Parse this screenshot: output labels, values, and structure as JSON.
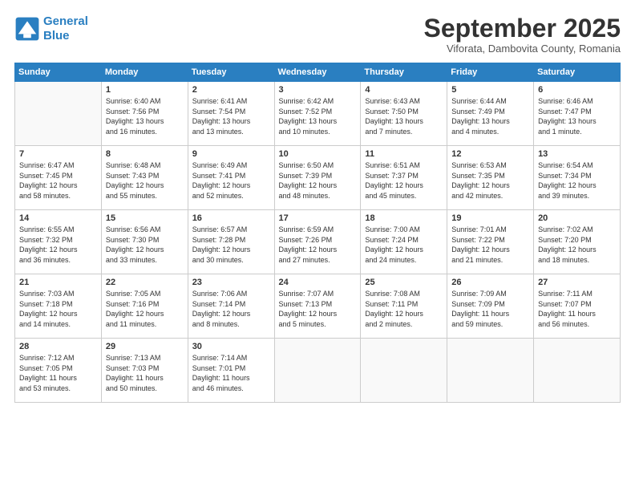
{
  "logo": {
    "line1": "General",
    "line2": "Blue"
  },
  "title": "September 2025",
  "subtitle": "Viforata, Dambovita County, Romania",
  "weekdays": [
    "Sunday",
    "Monday",
    "Tuesday",
    "Wednesday",
    "Thursday",
    "Friday",
    "Saturday"
  ],
  "weeks": [
    [
      {
        "day": "",
        "info": ""
      },
      {
        "day": "1",
        "info": "Sunrise: 6:40 AM\nSunset: 7:56 PM\nDaylight: 13 hours\nand 16 minutes."
      },
      {
        "day": "2",
        "info": "Sunrise: 6:41 AM\nSunset: 7:54 PM\nDaylight: 13 hours\nand 13 minutes."
      },
      {
        "day": "3",
        "info": "Sunrise: 6:42 AM\nSunset: 7:52 PM\nDaylight: 13 hours\nand 10 minutes."
      },
      {
        "day": "4",
        "info": "Sunrise: 6:43 AM\nSunset: 7:50 PM\nDaylight: 13 hours\nand 7 minutes."
      },
      {
        "day": "5",
        "info": "Sunrise: 6:44 AM\nSunset: 7:49 PM\nDaylight: 13 hours\nand 4 minutes."
      },
      {
        "day": "6",
        "info": "Sunrise: 6:46 AM\nSunset: 7:47 PM\nDaylight: 13 hours\nand 1 minute."
      }
    ],
    [
      {
        "day": "7",
        "info": "Sunrise: 6:47 AM\nSunset: 7:45 PM\nDaylight: 12 hours\nand 58 minutes."
      },
      {
        "day": "8",
        "info": "Sunrise: 6:48 AM\nSunset: 7:43 PM\nDaylight: 12 hours\nand 55 minutes."
      },
      {
        "day": "9",
        "info": "Sunrise: 6:49 AM\nSunset: 7:41 PM\nDaylight: 12 hours\nand 52 minutes."
      },
      {
        "day": "10",
        "info": "Sunrise: 6:50 AM\nSunset: 7:39 PM\nDaylight: 12 hours\nand 48 minutes."
      },
      {
        "day": "11",
        "info": "Sunrise: 6:51 AM\nSunset: 7:37 PM\nDaylight: 12 hours\nand 45 minutes."
      },
      {
        "day": "12",
        "info": "Sunrise: 6:53 AM\nSunset: 7:35 PM\nDaylight: 12 hours\nand 42 minutes."
      },
      {
        "day": "13",
        "info": "Sunrise: 6:54 AM\nSunset: 7:34 PM\nDaylight: 12 hours\nand 39 minutes."
      }
    ],
    [
      {
        "day": "14",
        "info": "Sunrise: 6:55 AM\nSunset: 7:32 PM\nDaylight: 12 hours\nand 36 minutes."
      },
      {
        "day": "15",
        "info": "Sunrise: 6:56 AM\nSunset: 7:30 PM\nDaylight: 12 hours\nand 33 minutes."
      },
      {
        "day": "16",
        "info": "Sunrise: 6:57 AM\nSunset: 7:28 PM\nDaylight: 12 hours\nand 30 minutes."
      },
      {
        "day": "17",
        "info": "Sunrise: 6:59 AM\nSunset: 7:26 PM\nDaylight: 12 hours\nand 27 minutes."
      },
      {
        "day": "18",
        "info": "Sunrise: 7:00 AM\nSunset: 7:24 PM\nDaylight: 12 hours\nand 24 minutes."
      },
      {
        "day": "19",
        "info": "Sunrise: 7:01 AM\nSunset: 7:22 PM\nDaylight: 12 hours\nand 21 minutes."
      },
      {
        "day": "20",
        "info": "Sunrise: 7:02 AM\nSunset: 7:20 PM\nDaylight: 12 hours\nand 18 minutes."
      }
    ],
    [
      {
        "day": "21",
        "info": "Sunrise: 7:03 AM\nSunset: 7:18 PM\nDaylight: 12 hours\nand 14 minutes."
      },
      {
        "day": "22",
        "info": "Sunrise: 7:05 AM\nSunset: 7:16 PM\nDaylight: 12 hours\nand 11 minutes."
      },
      {
        "day": "23",
        "info": "Sunrise: 7:06 AM\nSunset: 7:14 PM\nDaylight: 12 hours\nand 8 minutes."
      },
      {
        "day": "24",
        "info": "Sunrise: 7:07 AM\nSunset: 7:13 PM\nDaylight: 12 hours\nand 5 minutes."
      },
      {
        "day": "25",
        "info": "Sunrise: 7:08 AM\nSunset: 7:11 PM\nDaylight: 12 hours\nand 2 minutes."
      },
      {
        "day": "26",
        "info": "Sunrise: 7:09 AM\nSunset: 7:09 PM\nDaylight: 11 hours\nand 59 minutes."
      },
      {
        "day": "27",
        "info": "Sunrise: 7:11 AM\nSunset: 7:07 PM\nDaylight: 11 hours\nand 56 minutes."
      }
    ],
    [
      {
        "day": "28",
        "info": "Sunrise: 7:12 AM\nSunset: 7:05 PM\nDaylight: 11 hours\nand 53 minutes."
      },
      {
        "day": "29",
        "info": "Sunrise: 7:13 AM\nSunset: 7:03 PM\nDaylight: 11 hours\nand 50 minutes."
      },
      {
        "day": "30",
        "info": "Sunrise: 7:14 AM\nSunset: 7:01 PM\nDaylight: 11 hours\nand 46 minutes."
      },
      {
        "day": "",
        "info": ""
      },
      {
        "day": "",
        "info": ""
      },
      {
        "day": "",
        "info": ""
      },
      {
        "day": "",
        "info": ""
      }
    ]
  ]
}
